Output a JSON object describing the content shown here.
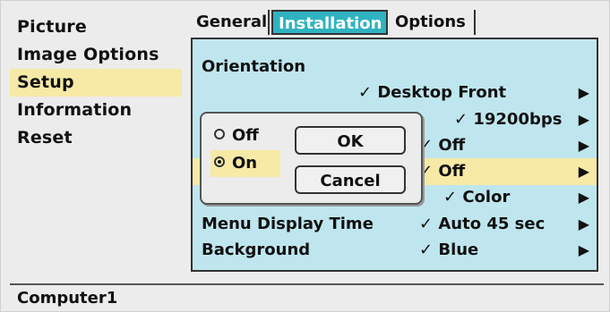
{
  "sidebar": {
    "items": [
      {
        "label": "Picture"
      },
      {
        "label": "Image Options"
      },
      {
        "label": "Setup"
      },
      {
        "label": "Information"
      },
      {
        "label": "Reset"
      }
    ],
    "active_index": 2
  },
  "tabs": [
    {
      "label": "General"
    },
    {
      "label": "Installation"
    },
    {
      "label": "Options"
    }
  ],
  "active_tab_index": 1,
  "panel": {
    "rows": [
      {
        "label": "Orientation",
        "value": "",
        "arrow": ""
      },
      {
        "label": "",
        "value": "✓ Desktop Front",
        "arrow": "▶"
      },
      {
        "label": "",
        "value": "✓ 19200bps",
        "arrow": "▶"
      },
      {
        "label": "",
        "value": "✓ Off",
        "arrow": "▶"
      },
      {
        "label": "",
        "value": "✓ Off",
        "arrow": "▶"
      },
      {
        "label": "",
        "value": "✓ Color",
        "arrow": "▶"
      },
      {
        "label": "Menu Display Time",
        "value": "✓ Auto 45 sec",
        "arrow": "▶"
      },
      {
        "label": "Background",
        "value": "✓ Blue",
        "arrow": "▶"
      }
    ]
  },
  "dialog": {
    "options": [
      {
        "label": "Off",
        "selected": false
      },
      {
        "label": "On",
        "selected": true
      }
    ],
    "ok_label": "OK",
    "cancel_label": "Cancel"
  },
  "status": {
    "source": "Computer1"
  },
  "colors": {
    "panel_bg": "#bfe6ee",
    "active_tab": "#2fb3c0",
    "highlight": "#f7e9a6",
    "window_bg": "#ececec"
  }
}
